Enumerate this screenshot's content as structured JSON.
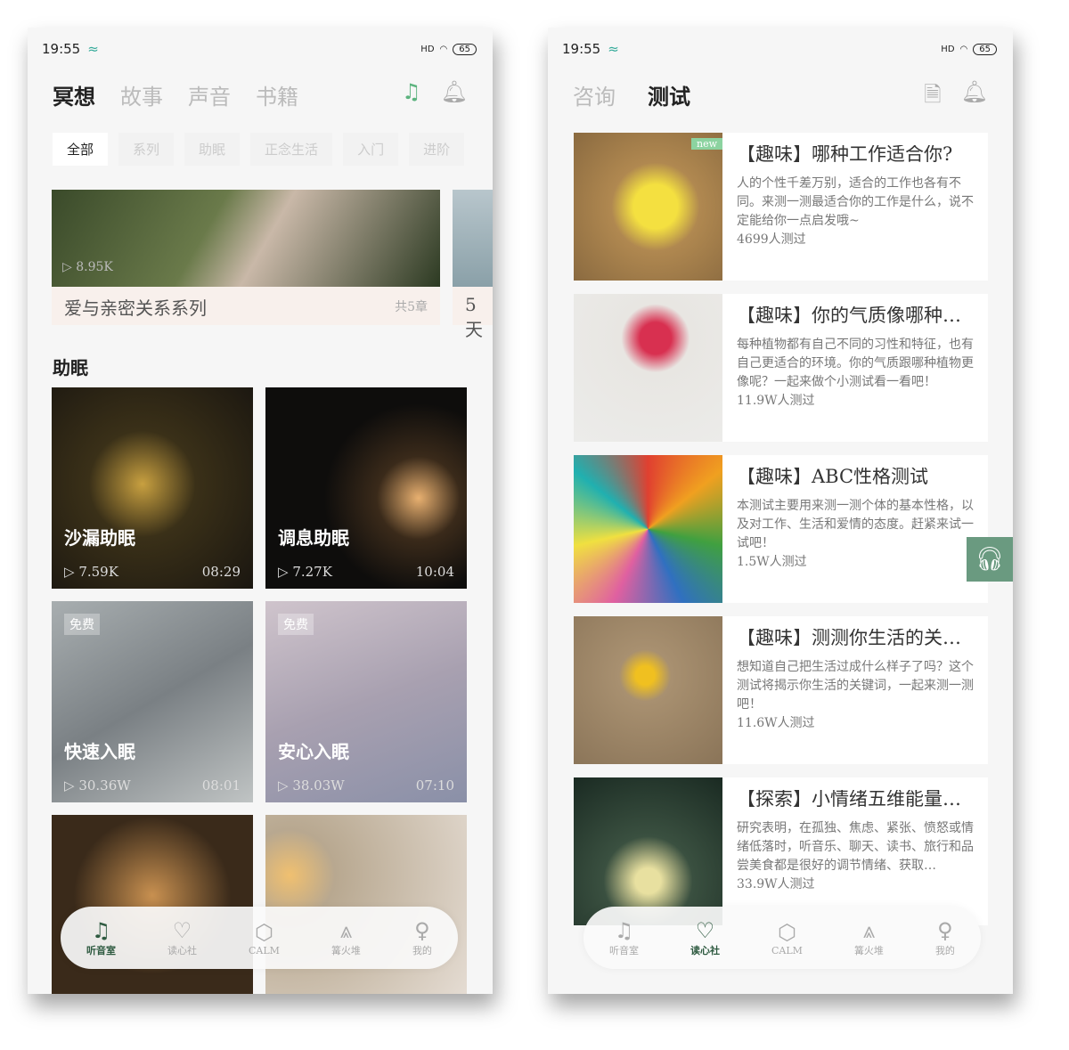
{
  "status": {
    "time": "19:55",
    "battery": "65",
    "signal": "HD"
  },
  "left": {
    "tabs": [
      "冥想",
      "故事",
      "声音",
      "书籍"
    ],
    "chips": [
      "全部",
      "系列",
      "助眠",
      "正念生活",
      "入门",
      "进阶"
    ],
    "banner": {
      "plays": "8.95K",
      "title": "爱与亲密关系系列",
      "chapters": "共5章"
    },
    "banner2": {
      "title": "5天"
    },
    "section": "助眠",
    "cards": [
      {
        "title": "沙漏助眠",
        "plays": "7.59K",
        "duration": "08:29",
        "free": ""
      },
      {
        "title": "调息助眠",
        "plays": "7.27K",
        "duration": "10:04",
        "free": ""
      },
      {
        "title": "快速入眠",
        "plays": "30.36W",
        "duration": "08:01",
        "free": "免费"
      },
      {
        "title": "安心入眠",
        "plays": "38.03W",
        "duration": "07:10",
        "free": "免费"
      }
    ]
  },
  "nav": [
    {
      "label": "听音室",
      "icon": "music-note-icon"
    },
    {
      "label": "读心社",
      "icon": "heart-icon"
    },
    {
      "label": "CALM",
      "icon": "hexagon-icon"
    },
    {
      "label": "篝火堆",
      "icon": "campfire-icon"
    },
    {
      "label": "我的",
      "icon": "person-icon"
    }
  ],
  "right": {
    "tabs": [
      "咨询",
      "测试"
    ],
    "badge": "new",
    "tests": [
      {
        "title": "【趣味】哪种工作适合你?",
        "desc": "人的个性千差万别，适合的工作也各有不同。来测一测最适合你的工作是什么，说不定能给你一点启发哦~",
        "count": "4699人测过"
      },
      {
        "title": "【趣味】你的气质像哪种…",
        "desc": "每种植物都有自己不同的习性和特征，也有自己更适合的环境。你的气质跟哪种植物更像呢？一起来做个小测试看一看吧！",
        "count": "11.9W人测过"
      },
      {
        "title": "【趣味】ABC性格测试",
        "desc": "本测试主要用来测一测个体的基本性格，以及对工作、生活和爱情的态度。赶紧来试一试吧！",
        "count": "1.5W人测过"
      },
      {
        "title": "【趣味】测测你生活的关…",
        "desc": "想知道自己把生活过成什么样子了吗？这个测试将揭示你生活的关键词，一起来测一测吧！",
        "count": "11.6W人测过"
      },
      {
        "title": "【探索】小情绪五维能量…",
        "desc": "研究表明，在孤独、焦虑、紧张、愤怒或情绪低落时，听音乐、聊天、读书、旅行和品尝美食都是很好的调节情绪、获取…",
        "count": "33.9W人测过"
      }
    ]
  }
}
